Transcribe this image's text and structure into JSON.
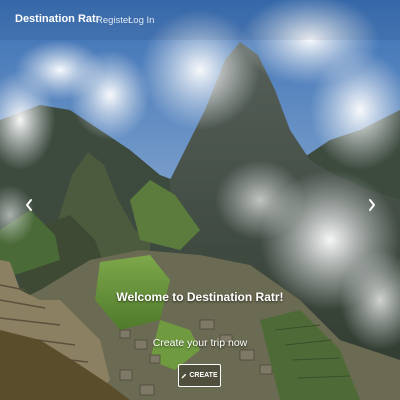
{
  "navbar": {
    "brand": "Destination Ratr",
    "links": [
      {
        "label": "Register"
      },
      {
        "label": "Log In"
      }
    ]
  },
  "carousel": {
    "prev_icon": "chevron-left-icon",
    "next_icon": "chevron-right-icon"
  },
  "hero": {
    "title": "Welcome to Destination Ratr!",
    "subtitle": "Create your trip now",
    "button_label": "CREATE",
    "button_icon": "pencil-icon"
  }
}
